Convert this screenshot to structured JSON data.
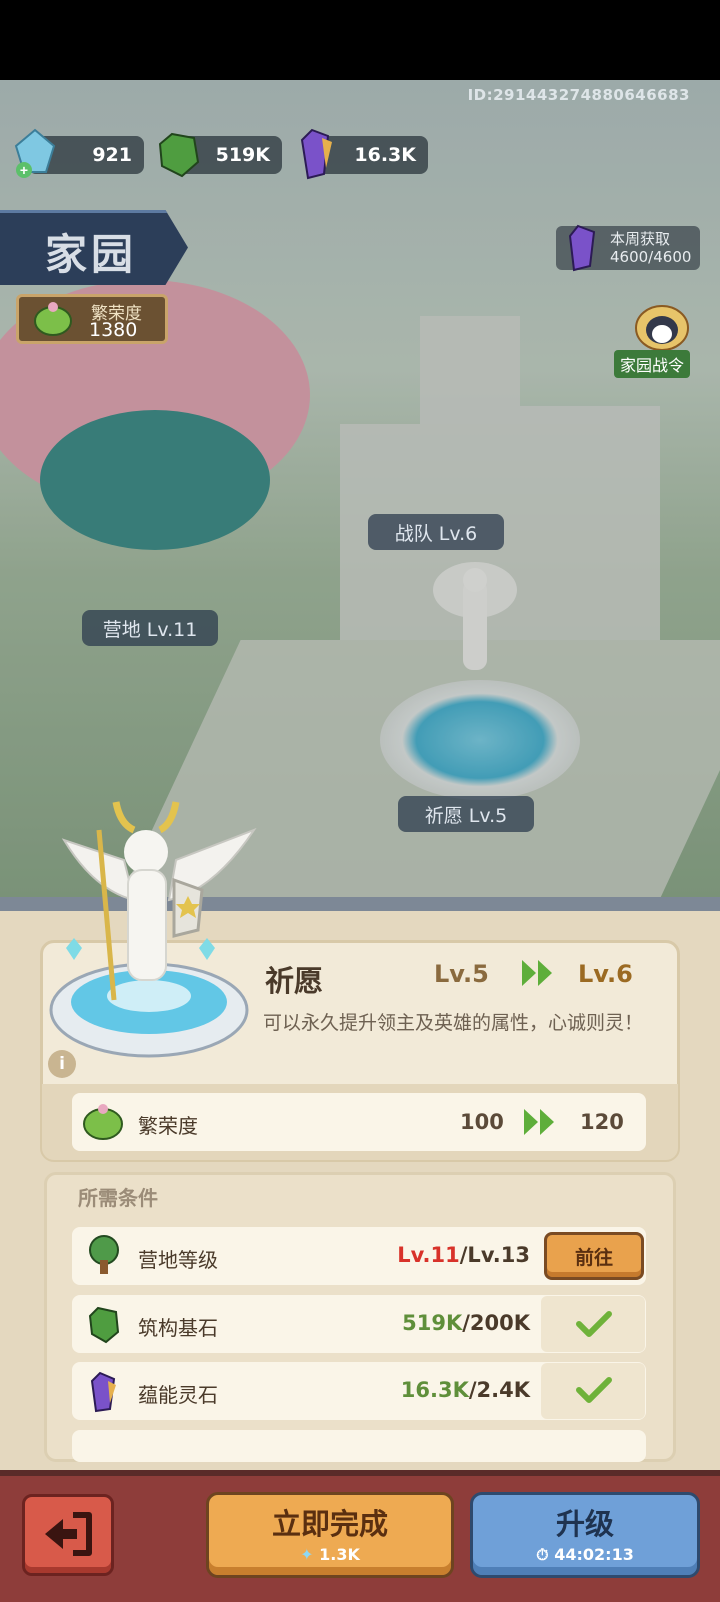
{
  "top": {
    "player_id": "ID:291443274880646683",
    "resources": [
      {
        "name": "diamond-currency",
        "value": "921"
      },
      {
        "name": "building-stone",
        "value": "519K"
      },
      {
        "name": "energy-crystal",
        "value": "16.3K"
      }
    ],
    "home_title": "家园",
    "prosperity": {
      "label": "繁荣度",
      "value": "1380"
    },
    "weekly": {
      "label": "本周获取",
      "value": "4600/4600"
    },
    "battle_pass": "家园战令"
  },
  "scene": {
    "tags": {
      "team": "战队 Lv.6",
      "camp": "营地 Lv.11",
      "wish": "祈愿 Lv.5"
    }
  },
  "panel": {
    "building_name": "祈愿",
    "level_from": "Lv.5",
    "level_to": "Lv.6",
    "description": "可以永久提升领主及英雄的属性，心诚则灵！",
    "prosperity": {
      "label": "繁荣度",
      "from": "100",
      "to": "120"
    },
    "requirements_title": "所需条件",
    "requirements": [
      {
        "name": "营地等级",
        "current": "Lv.11",
        "required": "/Lv.13",
        "action": "前往",
        "met": false
      },
      {
        "name": "筑构基石",
        "current": "519K",
        "required": "/200K",
        "met": true
      },
      {
        "name": "蕴能灵石",
        "current": "16.3K",
        "required": "/2.4K",
        "met": true
      }
    ]
  },
  "buttons": {
    "finish_now": "立即完成",
    "finish_cost": "1.3K",
    "upgrade": "升级",
    "upgrade_time": "44:02:13"
  },
  "colors": {
    "unmet": "#d8322a",
    "met": "#5f8f3a",
    "check": "#6fb23a"
  }
}
